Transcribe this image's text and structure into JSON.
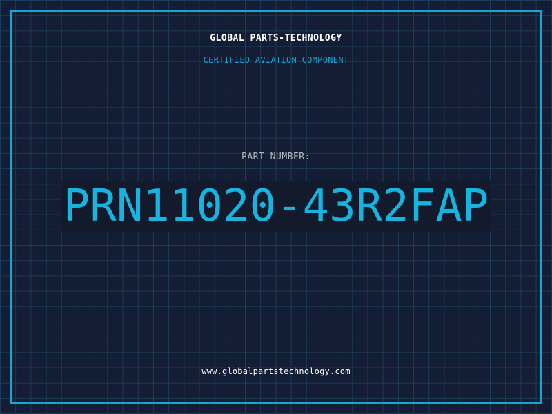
{
  "brand": {
    "company_name": "GLOBAL PARTS-TECHNOLOGY",
    "tagline": "CERTIFIED AVIATION COMPONENT",
    "website": "www.globalpartstechnology.com"
  },
  "part": {
    "label": "PART NUMBER:",
    "number": "PRN11020-43R2FAP"
  },
  "colors": {
    "background": "#131d33",
    "grid": "#1d3a57",
    "accent": "#1aa3d6",
    "part_number": "#16b4df",
    "primary_text": "#ffffff",
    "label_text": "#aeb7c3"
  }
}
